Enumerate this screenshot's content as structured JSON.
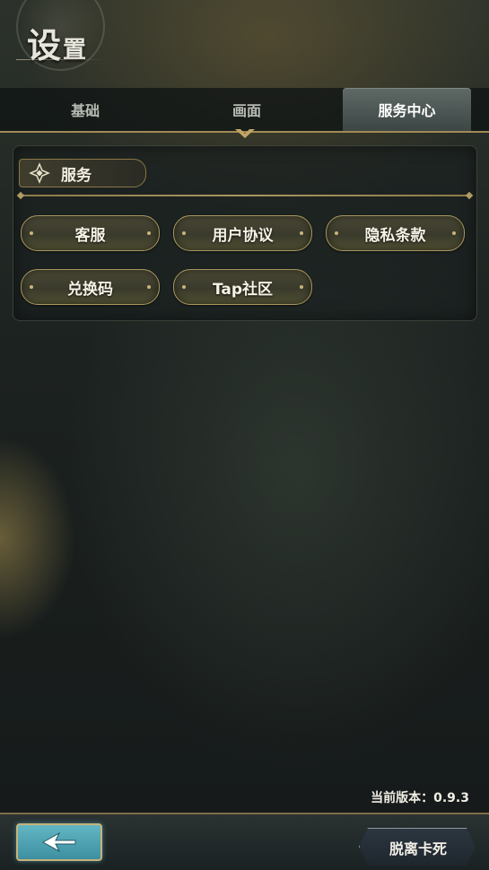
{
  "header": {
    "title_big": "设",
    "title_small": "置"
  },
  "tabs": [
    {
      "label": "基础",
      "active": false
    },
    {
      "label": "画面",
      "active": false
    },
    {
      "label": "服务中心",
      "active": true
    }
  ],
  "service_section": {
    "label": "服务",
    "icon": "diamond-ornament-icon",
    "buttons": {
      "customer_service": "客服",
      "user_agreement": "用户协议",
      "privacy_policy": "隐私条款",
      "redeem_code": "兑换码",
      "tap_community": "Tap社区"
    }
  },
  "footer": {
    "version_text": "当前版本：0.9.3",
    "back_icon": "arrow-left-icon",
    "unstuck_label": "脱离卡死"
  },
  "colors": {
    "accent_gold": "#a8965e",
    "active_tab": "#5f6a67",
    "back_button": "#4fa3b2"
  }
}
